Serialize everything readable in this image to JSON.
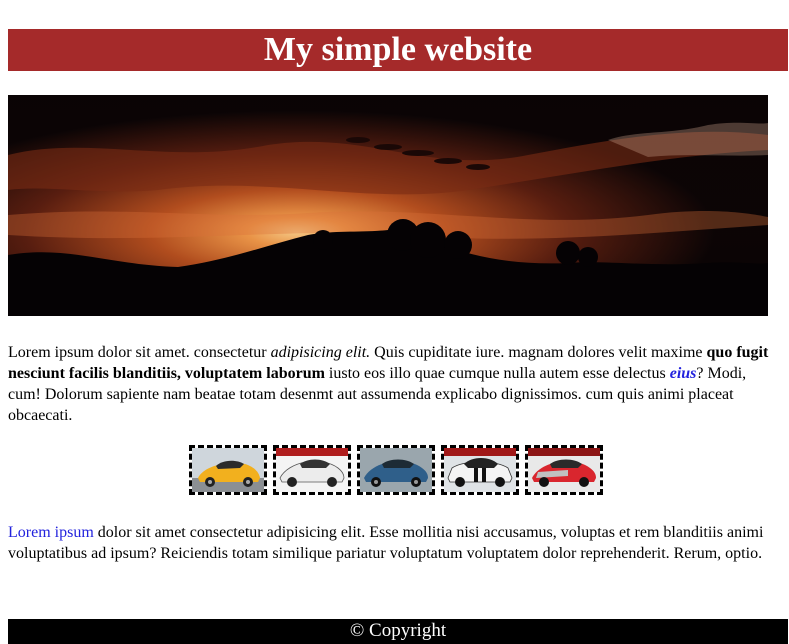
{
  "header": {
    "title": "My simple website"
  },
  "hero": {
    "alt": "sunset over hills"
  },
  "intro": {
    "t1": "Lorem ipsum dolor sit amet. consectetur ",
    "em1": "adipisicing elit.",
    "t2": " Quis cupiditate iure. magnam dolores velit maxime ",
    "b1": "quo fugit nesciunt facilis blanditiis, voluptatem laborum",
    "t3": " iusto eos illo quae cumque nulla autem esse delectus ",
    "link": "eius",
    "t4": "? Modi, cum! Dolorum sapiente nam beatae totam desenmt aut assumenda explicabo dignissimos. cum quis animi placeat obcaecati."
  },
  "gallery": {
    "items": [
      {
        "icon": "yellow-sports-car",
        "color": "#f2b01e"
      },
      {
        "icon": "white-sports-car",
        "color": "#e8e8e8"
      },
      {
        "icon": "blue-sports-car",
        "color": "#2f5f8a"
      },
      {
        "icon": "white-black-muscle-car",
        "color": "#f0f0f0"
      },
      {
        "icon": "red-sports-car",
        "color": "#d9262e"
      }
    ]
  },
  "second": {
    "link": "Lorem ipsum",
    "text": " dolor sit amet consectetur adipisicing elit. Esse mollitia nisi accusamus, voluptas et rem blanditiis animi voluptatibus ad ipsum? Reiciendis totam similique pariatur voluptatum voluptatem dolor reprehenderit. Rerum, optio."
  },
  "footer": {
    "text": "© Copyright"
  }
}
